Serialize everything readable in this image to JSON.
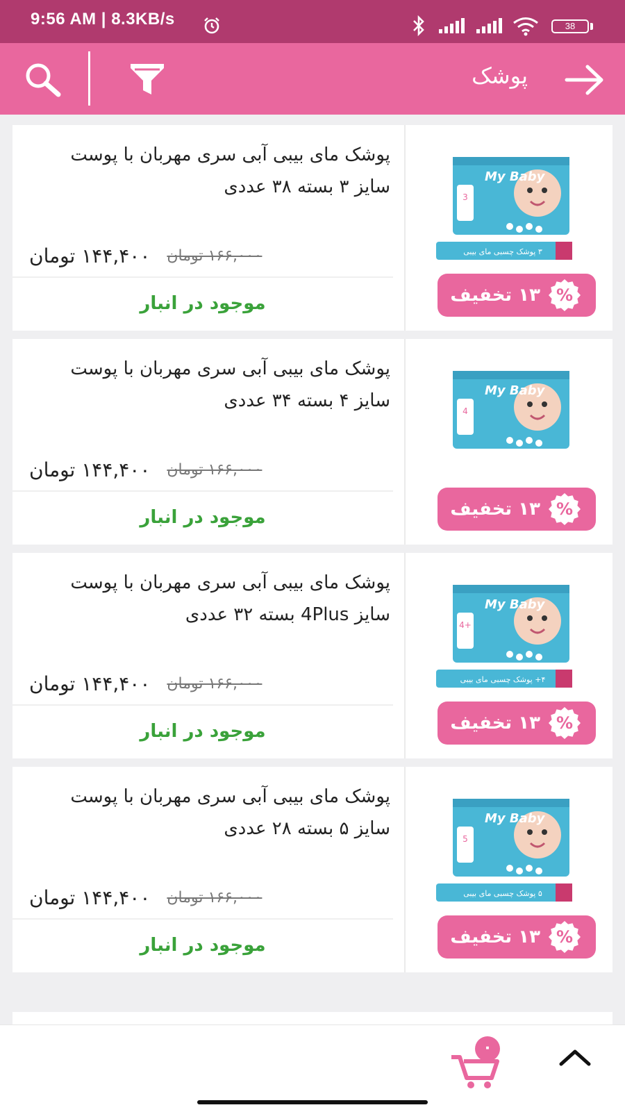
{
  "status_bar": {
    "time": "9:56 AM | 8.3KB/s",
    "battery": "38",
    "icons": [
      "alarm-icon",
      "bluetooth-icon",
      "signal-icon",
      "signal-icon",
      "wifi-icon",
      "battery-icon"
    ]
  },
  "app_bar": {
    "title": "پوشک",
    "icons": [
      "back-arrow-icon",
      "filter-icon",
      "search-icon"
    ]
  },
  "colors": {
    "status_bar": "#b03a6e",
    "app_bar": "#e9679e",
    "badge": "#e9679e",
    "stock": "#3aa23a"
  },
  "products": [
    {
      "title": "پوشک مای بیبی آبی سری مهربان با پوست سایز ۳ بسته ۳۸ عددی",
      "price_new": "۱۴۴,۴۰۰ تومان",
      "price_old": "۱۶۶,۰۰۰ تومان",
      "discount": "۱۳ تخفیف",
      "percent": "%",
      "stock": "موجود در انبار",
      "image_label": "۳ پوشک چسبی مای بیبی",
      "image_brand": "My Baby",
      "image_size": "3"
    },
    {
      "title": "پوشک مای بیبی آبی سری مهربان با پوست سایز ۴ بسته ۳۴ عددی",
      "price_new": "۱۴۴,۴۰۰ تومان",
      "price_old": "۱۶۶,۰۰۰ تومان",
      "discount": "۱۳ تخفیف",
      "percent": "%",
      "stock": "موجود در انبار",
      "image_label": "",
      "image_brand": "My Baby",
      "image_size": "4"
    },
    {
      "title": "پوشک مای بیبی آبی سری مهربان با پوست سایز 4Plus بسته ۳۲ عددی",
      "price_new": "۱۴۴,۴۰۰ تومان",
      "price_old": "۱۶۶,۰۰۰ تومان",
      "discount": "۱۳ تخفیف",
      "percent": "%",
      "stock": "موجود در انبار",
      "image_label": "۴+ پوشک چسبی مای بیبی",
      "image_brand": "My Baby",
      "image_size": "4+"
    },
    {
      "title": "پوشک مای بیبی آبی سری مهربان با پوست سایز ۵ بسته ۲۸ عددی",
      "price_new": "۱۴۴,۴۰۰ تومان",
      "price_old": "۱۶۶,۰۰۰ تومان",
      "discount": "۱۳ تخفیف",
      "percent": "%",
      "stock": "موجود در انبار",
      "image_label": "۵ پوشک چسبی مای بیبی",
      "image_brand": "My Baby",
      "image_size": "5"
    }
  ],
  "bottom_bar": {
    "cart_count": "۰",
    "icons": [
      "cart-icon",
      "chevron-up-icon"
    ]
  }
}
